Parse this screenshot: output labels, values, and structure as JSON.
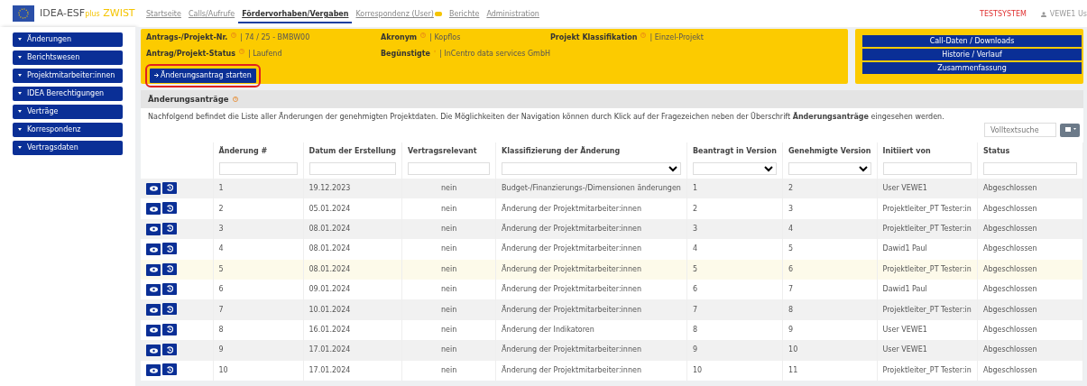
{
  "app": {
    "title": "IDEA-ESF",
    "title_sub": "plus",
    "title_suffix": "ZWIST"
  },
  "nav": [
    {
      "label": "Startseite",
      "selected": false
    },
    {
      "label": "Calls/Aufrufe",
      "selected": false
    },
    {
      "label": "Fördervorhaben/Vergaben",
      "selected": true
    },
    {
      "label": "Korrespondenz (User)",
      "selected": false,
      "badge": true
    },
    {
      "label": "Berichte",
      "selected": false
    },
    {
      "label": "Administration",
      "selected": false
    }
  ],
  "system_label": "TESTSYSTEM",
  "user": "VEWE1 Us",
  "sidebar": {
    "items": [
      "Änderungen",
      "Berichtswesen",
      "Projektmitarbeiter:innen",
      "IDEA Berechtigungen",
      "Verträge",
      "Korrespondenz",
      "Vertragsdaten"
    ]
  },
  "project_info": {
    "fields": [
      {
        "label": "Antrags-/Projekt-Nr.",
        "value": "| 74 / 25 - BMBW00"
      },
      {
        "label": "Akronym",
        "value": "| Kopflos"
      },
      {
        "label": "Projekt Klassifikation",
        "value": "| Einzel-Projekt"
      },
      {
        "label": "Antrag/Projekt-Status",
        "value": "| Laufend"
      },
      {
        "label": "Begünstigte",
        "value": "| InCentro data services GmbH"
      }
    ],
    "start_button": "Änderungsantrag starten"
  },
  "side_buttons": [
    "Call-Daten / Downloads",
    "Historie / Verlauf",
    "Zusammenfassung"
  ],
  "section": {
    "title": "Änderungsanträge",
    "description": "Nachfolgend befindet die Liste aller Änderungen der genehmigten Projektdaten. Die Möglichkeiten der Navigation können durch Klick auf der Fragezeichen neben der Überschrift **Änderungsanträge** eingesehen werden.",
    "search_placeholder": "Volltextsuche"
  },
  "table": {
    "columns": [
      {
        "label": "Änderung #",
        "kind": "text"
      },
      {
        "label": "Datum der Erstellung",
        "kind": "text"
      },
      {
        "label": "Vertragsrelevant",
        "kind": "text"
      },
      {
        "label": "Klassifizierung der Änderung",
        "kind": "select"
      },
      {
        "label": "Beantragt in Version",
        "kind": "select"
      },
      {
        "label": "Genehmigte Version",
        "kind": "select"
      },
      {
        "label": "Initiiert von",
        "kind": "text"
      },
      {
        "label": "Status",
        "kind": "text"
      }
    ],
    "rows": [
      {
        "highlighted": false,
        "cells": [
          "1",
          "19.12.2023",
          "nein",
          "Budget-/Finanzierungs-/Dimensionen änderungen",
          "1",
          "2",
          "User VEWE1",
          "Abgeschlossen"
        ]
      },
      {
        "highlighted": false,
        "cells": [
          "2",
          "05.01.2024",
          "nein",
          "Änderung der Projektmitarbeiter:innen",
          "2",
          "3",
          "Projektleiter_PT Tester:in",
          "Abgeschlossen"
        ]
      },
      {
        "highlighted": false,
        "cells": [
          "3",
          "08.01.2024",
          "nein",
          "Änderung der Projektmitarbeiter:innen",
          "3",
          "4",
          "Projektleiter_PT Tester:in",
          "Abgeschlossen"
        ]
      },
      {
        "highlighted": false,
        "cells": [
          "4",
          "08.01.2024",
          "nein",
          "Änderung der Projektmitarbeiter:innen",
          "4",
          "5",
          "Dawid1 Paul",
          "Abgeschlossen"
        ]
      },
      {
        "highlighted": true,
        "cells": [
          "5",
          "08.01.2024",
          "nein",
          "Änderung der Projektmitarbeiter:innen",
          "5",
          "6",
          "Projektleiter_PT Tester:in",
          "Abgeschlossen"
        ]
      },
      {
        "highlighted": false,
        "cells": [
          "6",
          "09.01.2024",
          "nein",
          "Änderung der Projektmitarbeiter:innen",
          "6",
          "7",
          "Dawid1 Paul",
          "Abgeschlossen"
        ]
      },
      {
        "highlighted": false,
        "cells": [
          "7",
          "10.01.2024",
          "nein",
          "Änderung der Projektmitarbeiter:innen",
          "7",
          "8",
          "Projektleiter_PT Tester:in",
          "Abgeschlossen"
        ]
      },
      {
        "highlighted": false,
        "cells": [
          "8",
          "16.01.2024",
          "nein",
          "Änderung der Indikatoren",
          "8",
          "9",
          "User VEWE1",
          "Abgeschlossen"
        ]
      },
      {
        "highlighted": false,
        "cells": [
          "9",
          "17.01.2024",
          "nein",
          "Änderung der Projektmitarbeiter:innen",
          "9",
          "10",
          "User VEWE1",
          "Abgeschlossen"
        ]
      },
      {
        "highlighted": false,
        "cells": [
          "10",
          "17.01.2024",
          "nein",
          "Änderung der Projektmitarbeiter:innen",
          "10",
          "11",
          "Projektleiter_PT Tester:in",
          "Abgeschlossen"
        ]
      }
    ]
  }
}
